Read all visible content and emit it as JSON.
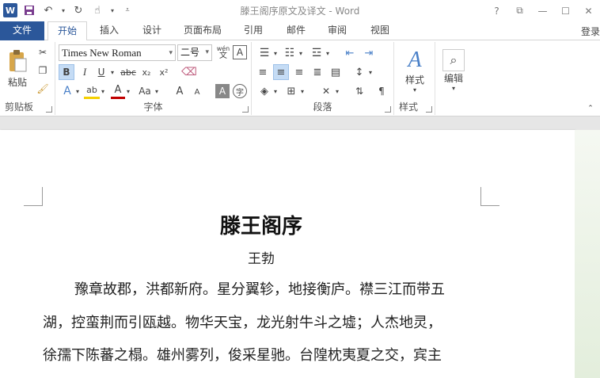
{
  "titlebar": {
    "app_letter": "W",
    "doc_title": "滕王阁序原文及译文 - Word",
    "help": "?",
    "ribbon_display": "⧉",
    "minimize": "—",
    "maximize": "☐",
    "close": "✕"
  },
  "tabs": {
    "file": "文件",
    "home": "开始",
    "insert": "插入",
    "design": "设计",
    "layout": "页面布局",
    "references": "引用",
    "mailings": "邮件",
    "review": "审阅",
    "view": "视图",
    "login": "登录"
  },
  "ribbon": {
    "clipboard": {
      "paste": "粘贴",
      "label": "剪贴板"
    },
    "font": {
      "font_name": "Times New Roman",
      "font_size": "二号",
      "bold": "B",
      "italic": "I",
      "underline": "U",
      "strike": "abc",
      "subscript": "x₂",
      "superscript": "x²",
      "grow": "A",
      "shrink": "A",
      "case": "Aa",
      "wen": "wén",
      "wen_char": "文",
      "label": "字体"
    },
    "paragraph": {
      "label": "段落"
    },
    "styles": {
      "name": "样式",
      "label": "样式"
    },
    "editing": {
      "name": "编辑"
    }
  },
  "document": {
    "title": "滕王阁序",
    "author": "王勃",
    "lines": [
      "豫章故郡，洪都新府。星分翼轸，地接衡庐。襟三江而带五",
      "湖，控蛮荆而引瓯越。物华天宝，龙光射牛斗之墟；人杰地灵，",
      "徐孺下陈蕃之榻。雄州雾列，俊采星驰。台隍枕夷夏之交，宾主"
    ]
  },
  "colors": {
    "brand": "#2b579a",
    "page": "#ffffff",
    "canvas": "#e6e6e6"
  }
}
